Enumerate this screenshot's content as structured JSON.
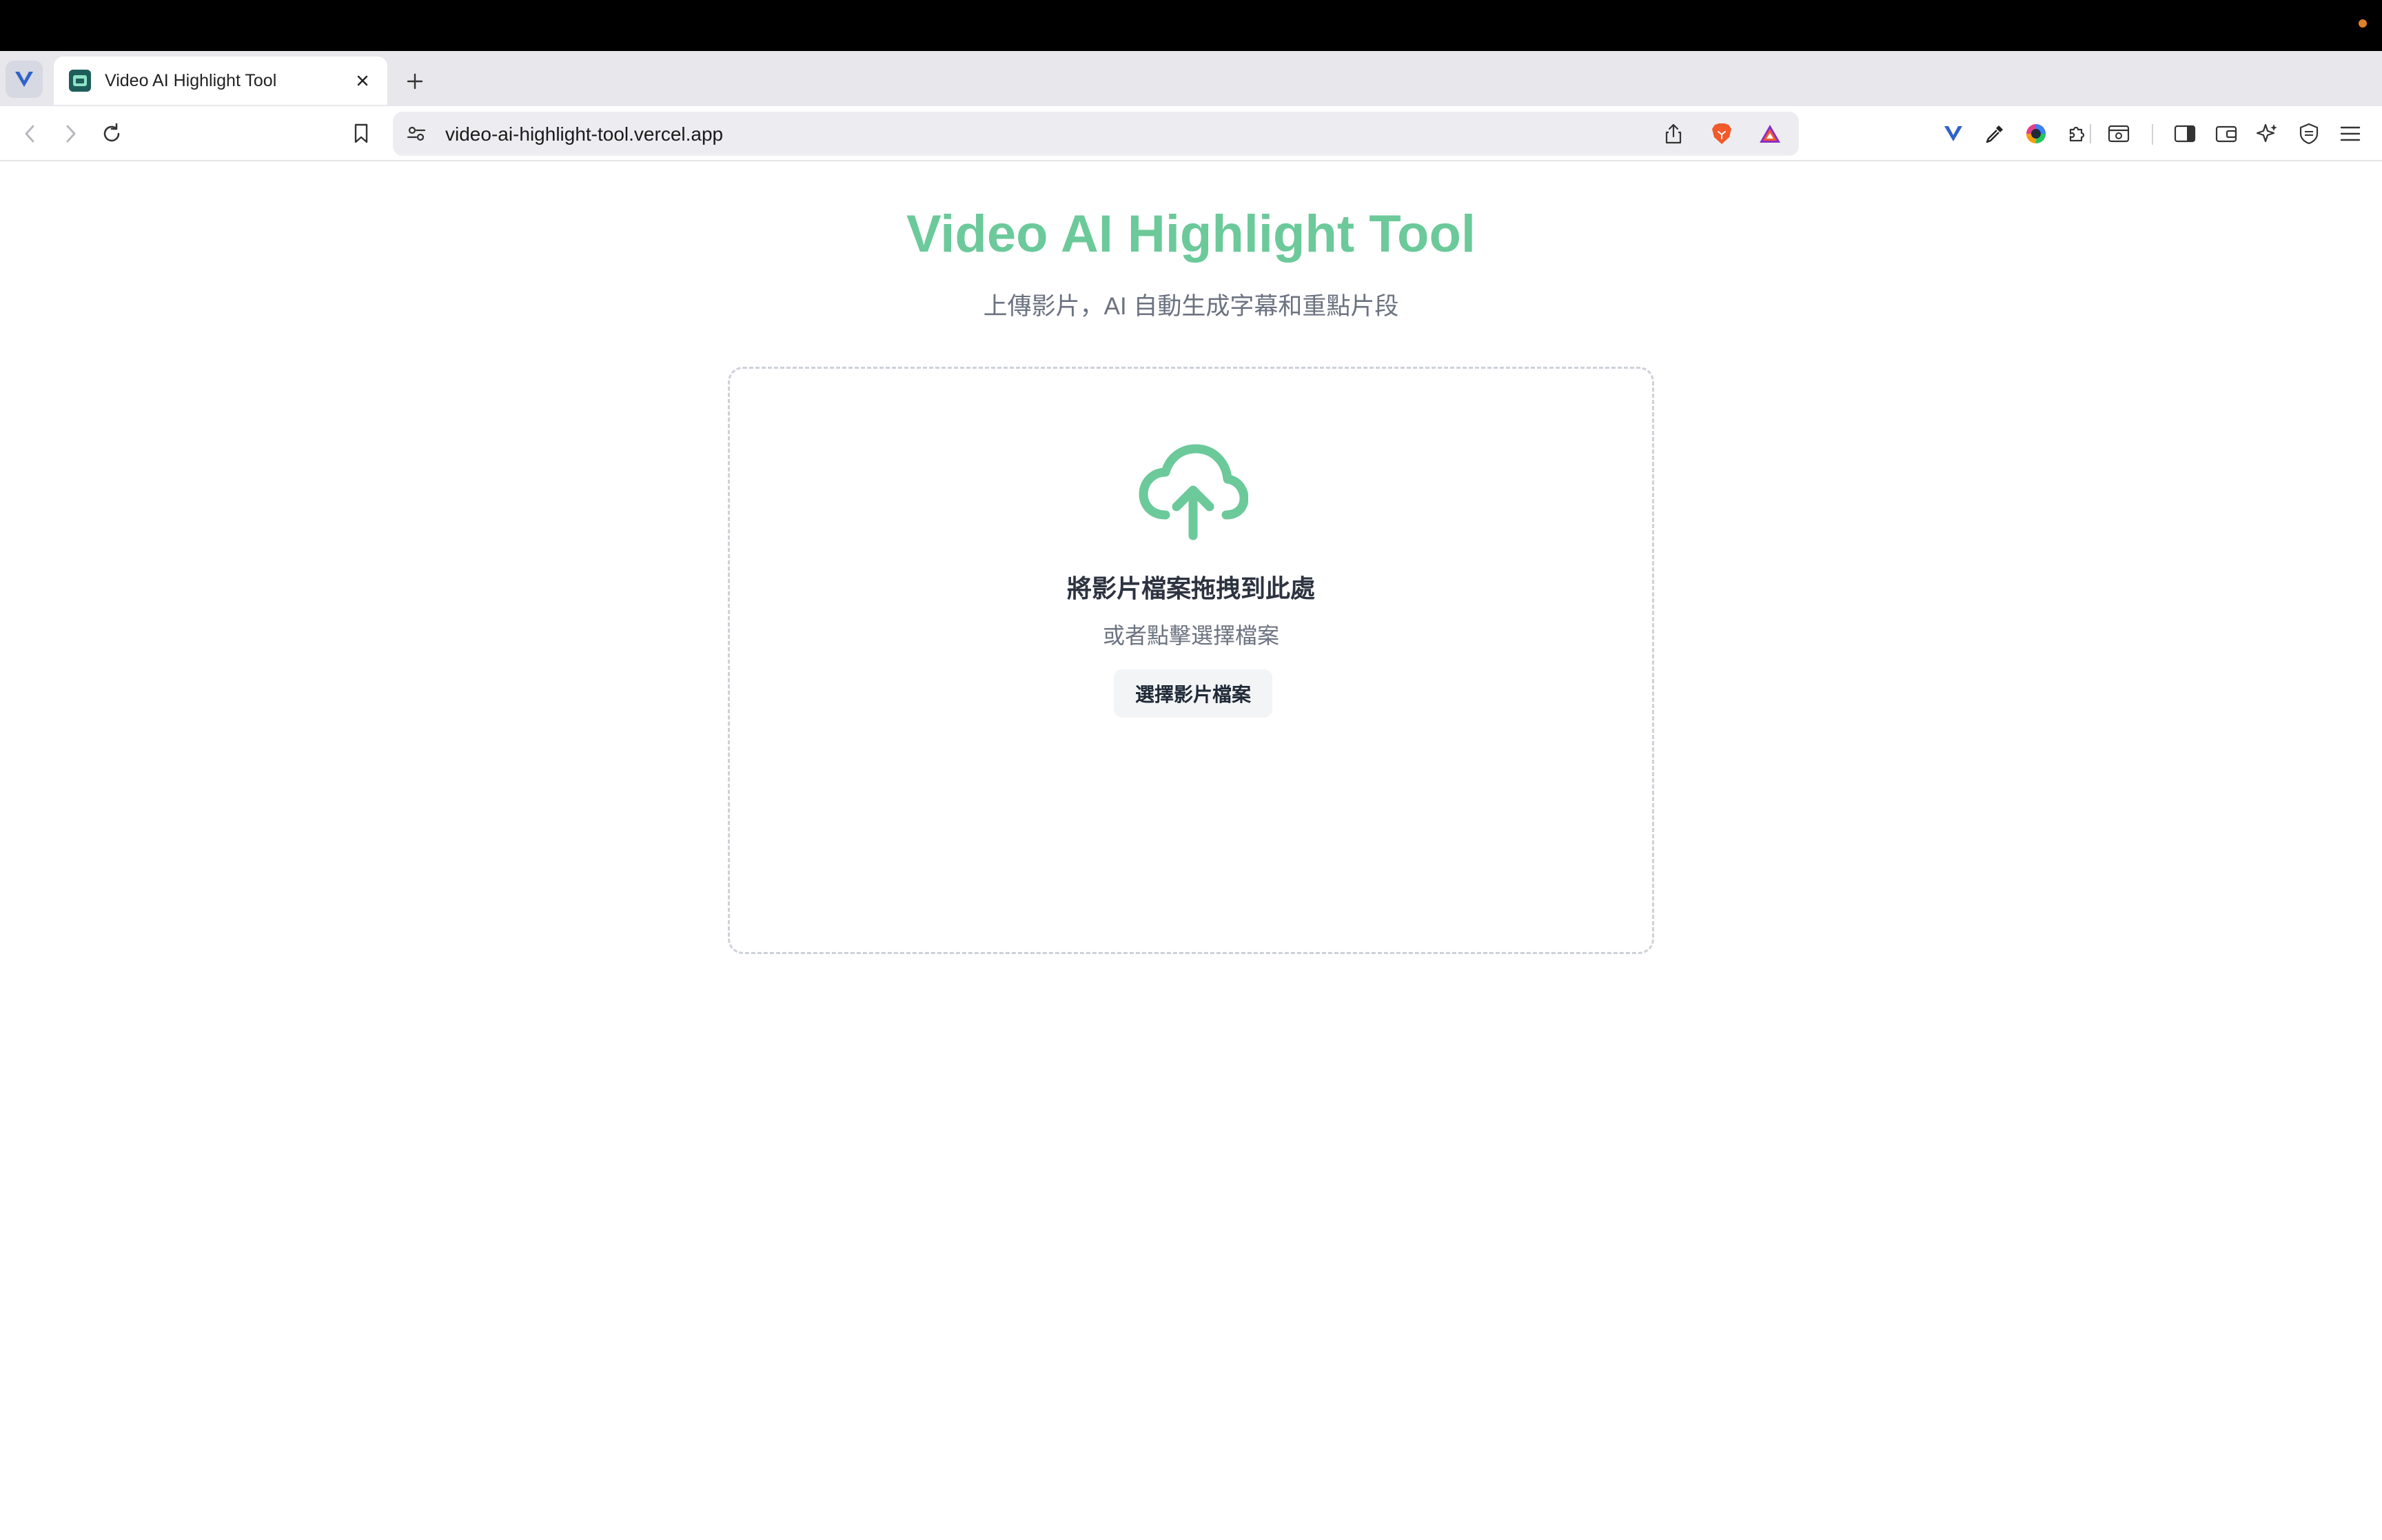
{
  "browser": {
    "tab": {
      "title": "Video AI Highlight Tool",
      "favicon": "video-app-icon"
    },
    "url": "video-ai-highlight-tool.vercel.app",
    "icons": {
      "sidebar_toggle": "vivaldi-v-icon",
      "close": "close-icon",
      "new_tab": "plus-icon",
      "back": "back-arrow-icon",
      "forward": "forward-arrow-icon",
      "reload": "reload-icon",
      "bookmark": "bookmark-icon",
      "site_settings": "site-settings-icon",
      "share": "share-icon",
      "brave_shields": "brave-lion-icon",
      "brave_rewards": "brave-rewards-triangle-icon",
      "extensions": [
        "vivaldi-v-icon",
        "eyedropper-icon",
        "color-circle-icon",
        "puzzle-icon",
        "reader-icon",
        "sidebar-panel-icon",
        "wallet-icon",
        "leo-ai-icon",
        "vpn-shield-icon",
        "menu-icon"
      ]
    },
    "colors": {
      "brave_orange": "#f15a2b",
      "recording_dot": "#e0802a"
    }
  },
  "page": {
    "title": "Video AI Highlight Tool",
    "subtitle": "上傳影片，AI 自動生成字幕和重點片段",
    "dropzone": {
      "icon": "cloud-upload-icon",
      "title": "將影片檔案拖拽到此處",
      "subtitle": "或者點擊選擇檔案",
      "button_label": "選擇影片檔案"
    },
    "colors": {
      "accent": "#6cc99a",
      "text_dark": "#2d3340",
      "text_muted": "#6b7280"
    }
  }
}
